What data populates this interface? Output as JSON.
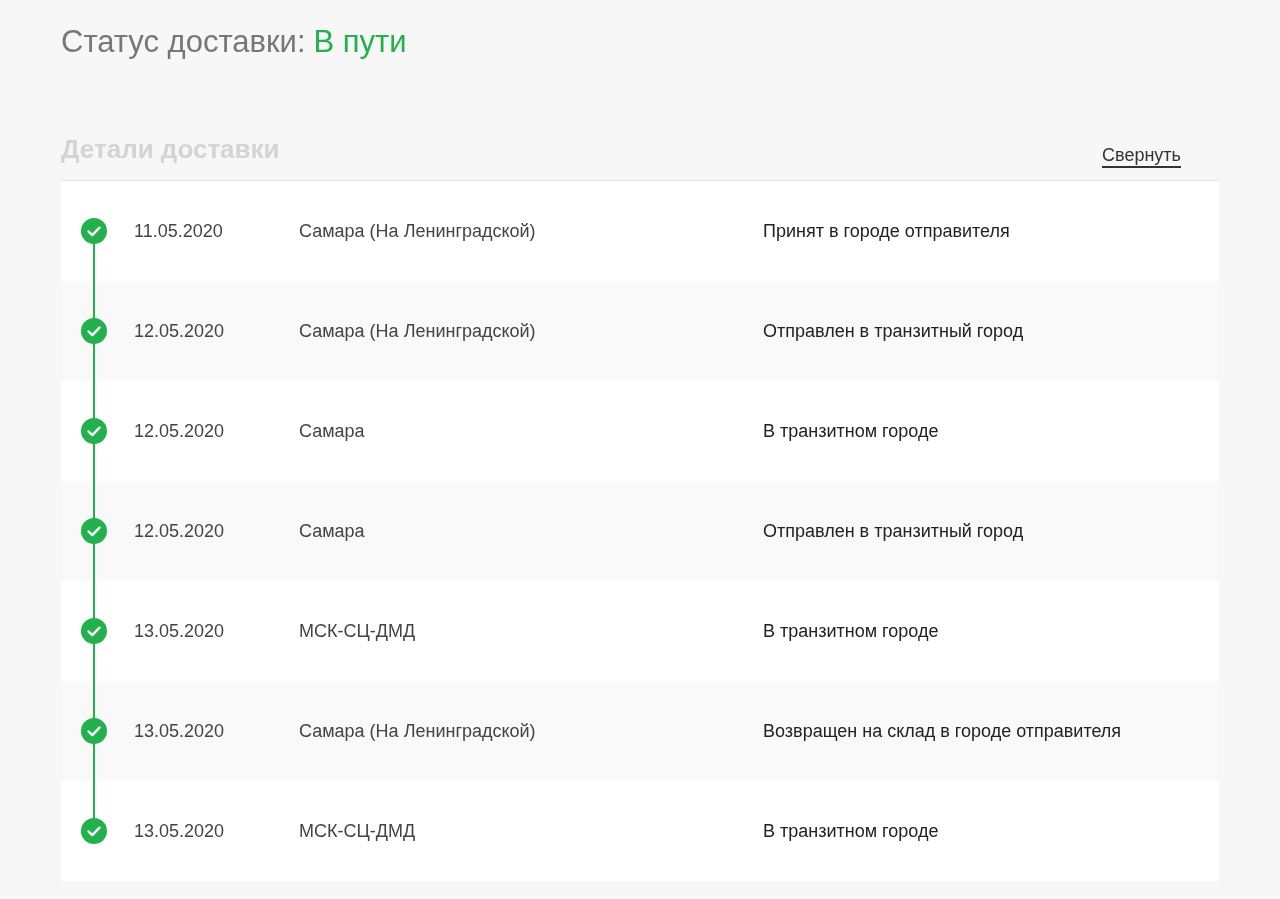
{
  "status": {
    "label": "Статус доставки:",
    "value": "В пути"
  },
  "details": {
    "title": "Детали доставки",
    "collapse_link": "Свернуть",
    "events": [
      {
        "date": "11.05.2020",
        "location": "Самара (На Ленинградской)",
        "status": "Принят в городе отправителя",
        "completed": true
      },
      {
        "date": "12.05.2020",
        "location": "Самара (На Ленинградской)",
        "status": "Отправлен в транзитный город",
        "completed": true
      },
      {
        "date": "12.05.2020",
        "location": "Самара",
        "status": "В транзитном городе",
        "completed": true
      },
      {
        "date": "12.05.2020",
        "location": "Самара",
        "status": "Отправлен в транзитный город",
        "completed": true
      },
      {
        "date": "13.05.2020",
        "location": "МСК-СЦ-ДМД",
        "status": "В транзитном городе",
        "completed": true
      },
      {
        "date": "13.05.2020",
        "location": "Самара (На Ленинградской)",
        "status": "Возвращен на склад в городе отправителя",
        "completed": true
      },
      {
        "date": "13.05.2020",
        "location": "МСК-СЦ-ДМД",
        "status": "В транзитном городе",
        "completed": true
      }
    ]
  }
}
